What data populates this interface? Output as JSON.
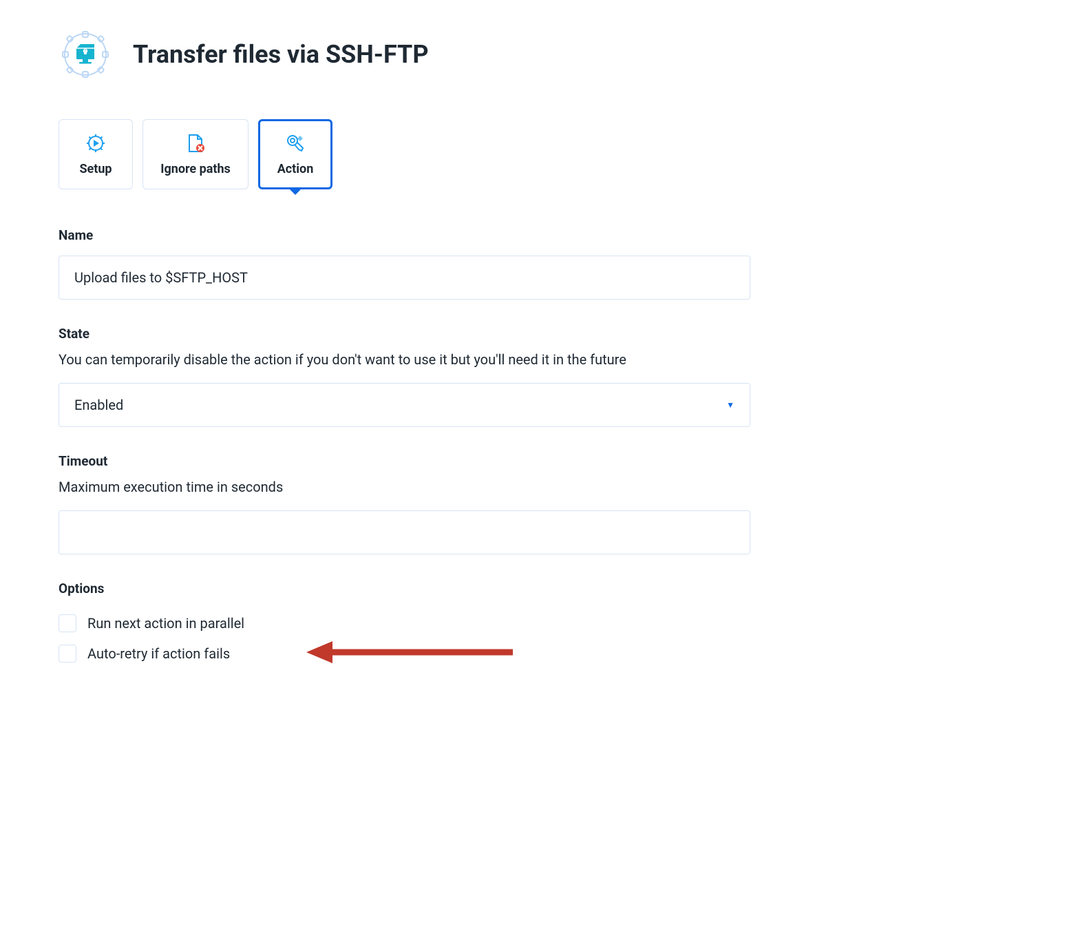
{
  "header": {
    "title": "Transfer files via SSH-FTP"
  },
  "tabs": [
    {
      "label": "Setup",
      "icon": "play-gear-icon",
      "active": false
    },
    {
      "label": "Ignore paths",
      "icon": "file-x-icon",
      "active": false
    },
    {
      "label": "Action",
      "icon": "tools-icon",
      "active": true
    }
  ],
  "form": {
    "name": {
      "label": "Name",
      "value": "Upload files to $SFTP_HOST"
    },
    "state": {
      "label": "State",
      "help": "You can temporarily disable the action if you don't want to use it but you'll need it in the future",
      "selected": "Enabled"
    },
    "timeout": {
      "label": "Timeout",
      "help": "Maximum execution time in seconds",
      "value": ""
    },
    "options": {
      "label": "Options",
      "items": [
        {
          "label": "Run next action in parallel",
          "checked": false
        },
        {
          "label": "Auto-retry if action fails",
          "checked": false,
          "annotated": true
        }
      ]
    }
  }
}
